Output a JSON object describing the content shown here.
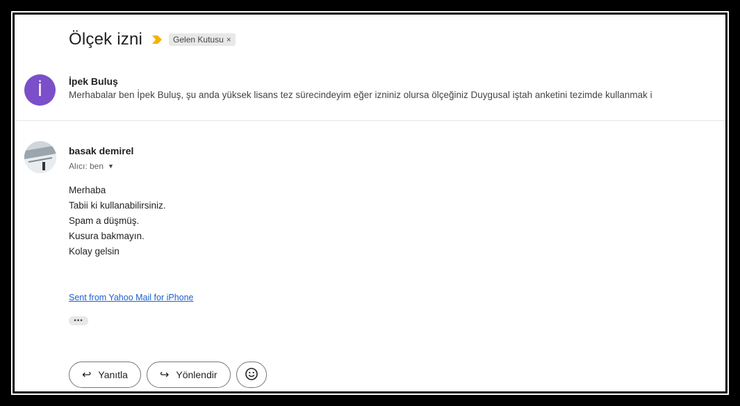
{
  "thread": {
    "subject": "Ölçek izni",
    "label_chip": "Gelen Kutusu",
    "label_close": "×"
  },
  "message1": {
    "avatar_letter": "İ",
    "avatar_color": "#7b4fc9",
    "sender": "İpek Buluş",
    "snippet": "Merhabalar ben İpek Buluş, şu anda yüksek lisans tez sürecindeyim eğer izniniz olursa ölçeğiniz Duygusal iştah anketini tezimde kullanmak i"
  },
  "message2": {
    "sender": "basak demirel",
    "recipient": "Alıcı: ben",
    "body": [
      "Merhaba",
      "Tabii ki kullanabilirsiniz.",
      "Spam a düşmüş.",
      "Kusura bakmayın.",
      "Kolay gelsin"
    ],
    "signature_link": "Sent from Yahoo Mail for iPhone",
    "more_dots": "•••"
  },
  "actions": {
    "reply_label": "Yanıtla",
    "forward_label": "Yönlendir"
  },
  "icons": {
    "importance": "importance-marker-icon",
    "reply": "reply-icon",
    "forward": "forward-icon",
    "emoji": "emoji-icon"
  },
  "colors": {
    "importance": "#f4b400",
    "link": "#1a5fd0"
  }
}
